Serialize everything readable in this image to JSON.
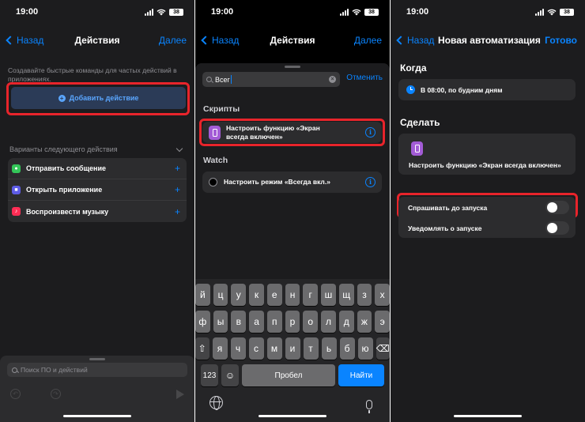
{
  "status": {
    "time": "19:00",
    "battery": "38"
  },
  "screen1": {
    "nav": {
      "back": "Назад",
      "title": "Действия",
      "done": "Далее"
    },
    "hint": "Создавайте быстрые команды для частых действий в приложениях.",
    "add_action": "Добавить действие",
    "suggestions_title": "Варианты следующего действия",
    "suggestions": [
      {
        "label": "Отправить сообщение",
        "icon": "message-icon",
        "color": "#34c759"
      },
      {
        "label": "Открыть приложение",
        "icon": "app-icon",
        "color": "#5e5ce6"
      },
      {
        "label": "Воспроизвести музыку",
        "icon": "music-icon",
        "color": "#ff2d55"
      }
    ],
    "search_placeholder": "Поиск ПО и действий"
  },
  "screen2": {
    "nav": {
      "back": "Назад",
      "title": "Действия",
      "done": "Далее"
    },
    "search_value": "Всег",
    "cancel": "Отменить",
    "scripts_title": "Скрипты",
    "script_item": "Настроить функцию «Экран всегда включен»",
    "watch_title": "Watch",
    "watch_item": "Настроить режим «Всегда вкл.»",
    "keyboard": {
      "row1": [
        "й",
        "ц",
        "у",
        "к",
        "е",
        "н",
        "г",
        "ш",
        "щ",
        "з",
        "х"
      ],
      "row2": [
        "ф",
        "ы",
        "в",
        "а",
        "п",
        "р",
        "о",
        "л",
        "д",
        "ж",
        "э"
      ],
      "row3": [
        "я",
        "ч",
        "с",
        "м",
        "и",
        "т",
        "ь",
        "б",
        "ю"
      ],
      "numbers": "123",
      "space": "Пробел",
      "find": "Найти"
    }
  },
  "screen3": {
    "nav": {
      "back": "Назад",
      "title": "Новая автоматизация",
      "done": "Готово"
    },
    "when_title": "Когда",
    "when_value": "В 08:00, по будним дням",
    "do_title": "Сделать",
    "do_value": "Настроить функцию «Экран всегда включен»",
    "ask_before": "Спрашивать до запуска",
    "notify": "Уведомлять о запуске"
  },
  "colors": {
    "accent": "#0a84ff",
    "highlight": "#e8242b",
    "background": "#1c1c1e",
    "card": "#2c2c2e"
  }
}
